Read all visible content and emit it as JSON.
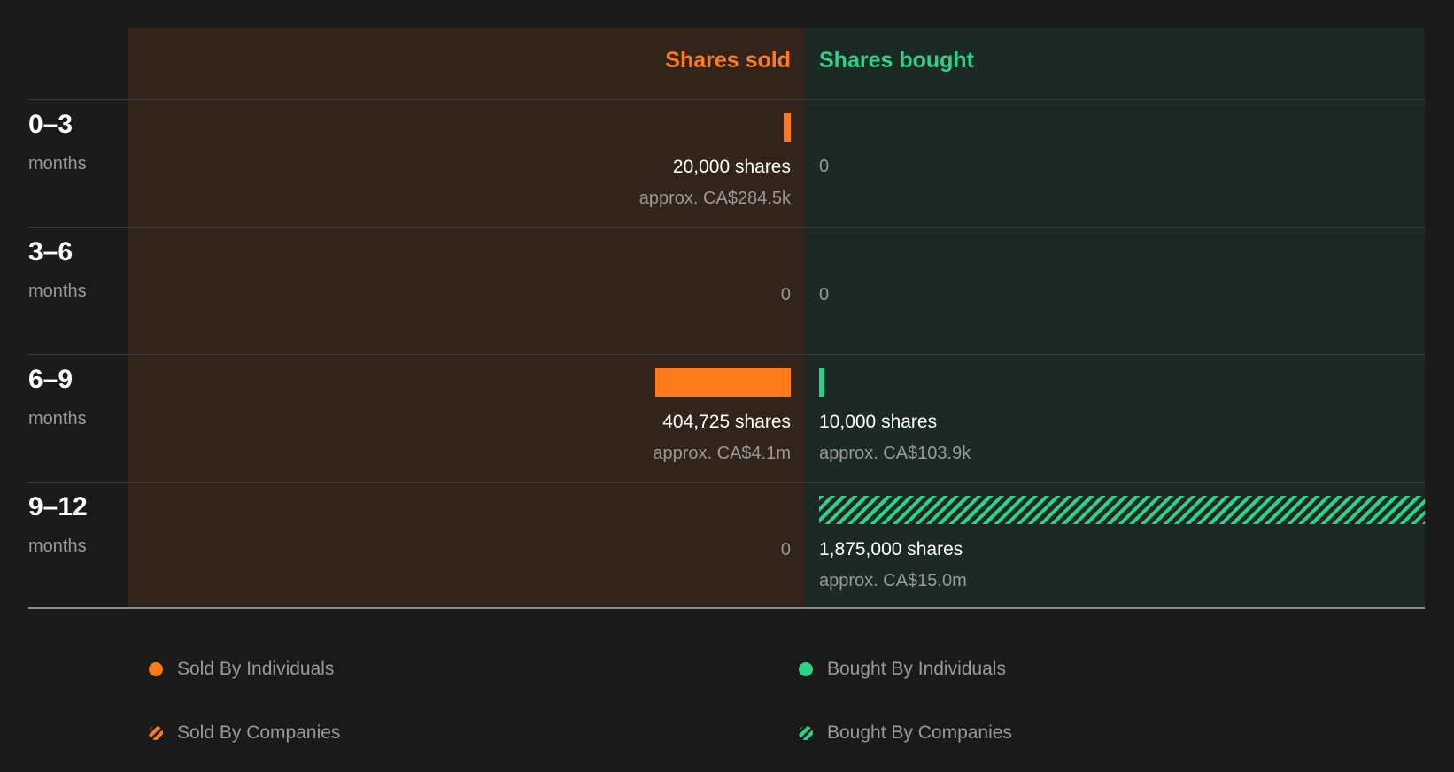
{
  "chart_data": {
    "type": "bar",
    "columns": {
      "sold_title": "Shares sold",
      "bought_title": "Shares bought"
    },
    "rows": [
      {
        "period": "0–3",
        "unit": "months",
        "sold": {
          "shares": 20000,
          "shares_label": "20,000 shares",
          "approx_label": "approx. CA$284.5k",
          "category": "individuals"
        },
        "bought": {
          "shares": 0,
          "zero_label": "0"
        }
      },
      {
        "period": "3–6",
        "unit": "months",
        "sold": {
          "shares": 0,
          "zero_label": "0"
        },
        "bought": {
          "shares": 0,
          "zero_label": "0"
        }
      },
      {
        "period": "6–9",
        "unit": "months",
        "sold": {
          "shares": 404725,
          "shares_label": "404,725 shares",
          "approx_label": "approx. CA$4.1m",
          "category": "individuals"
        },
        "bought": {
          "shares": 10000,
          "shares_label": "10,000 shares",
          "approx_label": "approx. CA$103.9k",
          "category": "individuals"
        }
      },
      {
        "period": "9–12",
        "unit": "months",
        "sold": {
          "shares": 0,
          "zero_label": "0"
        },
        "bought": {
          "shares": 1875000,
          "shares_label": "1,875,000 shares",
          "approx_label": "approx. CA$15.0m",
          "category": "companies"
        }
      }
    ],
    "legend": [
      {
        "key": "sold_ind",
        "label": "Sold By Individuals"
      },
      {
        "key": "bought_ind",
        "label": "Bought By Individuals"
      },
      {
        "key": "sold_co",
        "label": "Sold By Companies"
      },
      {
        "key": "bought_co",
        "label": "Bought By Companies"
      }
    ],
    "colors": {
      "sold": "#ff7a1a",
      "bought": "#2ed286",
      "sold_bg": "#32231b",
      "bought_bg": "#1c2925",
      "page_bg": "#1a1a1a"
    }
  }
}
